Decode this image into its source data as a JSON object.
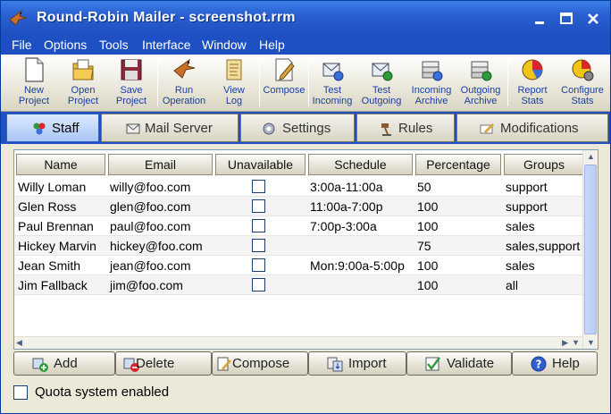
{
  "window": {
    "title": "Round-Robin Mailer - screenshot.rrm"
  },
  "menu": [
    "File",
    "Options",
    "Tools",
    "Interface",
    "Window",
    "Help"
  ],
  "toolbar": [
    {
      "l1": "New",
      "l2": "Project"
    },
    {
      "l1": "Open",
      "l2": "Project"
    },
    {
      "l1": "Save",
      "l2": "Project"
    },
    {
      "l1": "Run",
      "l2": "Operation"
    },
    {
      "l1": "View",
      "l2": "Log"
    },
    {
      "l1": "Compose",
      "l2": ""
    },
    {
      "l1": "Test",
      "l2": "Incoming"
    },
    {
      "l1": "Test",
      "l2": "Outgoing"
    },
    {
      "l1": "Incoming",
      "l2": "Archive"
    },
    {
      "l1": "Outgoing",
      "l2": "Archive"
    },
    {
      "l1": "Report",
      "l2": "Stats"
    },
    {
      "l1": "Configure",
      "l2": "Stats"
    }
  ],
  "tabs": [
    "Staff",
    "Mail Server",
    "Settings",
    "Rules",
    "Modifications"
  ],
  "table": {
    "columns": [
      "Name",
      "Email",
      "Unavailable",
      "Schedule",
      "Percentage",
      "Groups"
    ],
    "rows": [
      {
        "name": "Willy Loman",
        "email": "willy@foo.com",
        "unavailable": false,
        "schedule": "3:00a-11:00a",
        "percentage": "50",
        "groups": "support"
      },
      {
        "name": "Glen Ross",
        "email": "glen@foo.com",
        "unavailable": false,
        "schedule": "11:00a-7:00p",
        "percentage": "100",
        "groups": "support"
      },
      {
        "name": "Paul Brennan",
        "email": "paul@foo.com",
        "unavailable": false,
        "schedule": "7:00p-3:00a",
        "percentage": "100",
        "groups": "sales"
      },
      {
        "name": "Hickey Marvin",
        "email": "hickey@foo.com",
        "unavailable": false,
        "schedule": "",
        "percentage": "75",
        "groups": "sales,support"
      },
      {
        "name": "Jean Smith",
        "email": "jean@foo.com",
        "unavailable": false,
        "schedule": "Mon:9:00a-5:00p",
        "percentage": "100",
        "groups": "sales"
      },
      {
        "name": "Jim Fallback",
        "email": "jim@foo.com",
        "unavailable": false,
        "schedule": "",
        "percentage": "100",
        "groups": "all"
      }
    ]
  },
  "buttons": [
    "Add",
    "Delete",
    "Compose",
    "Import",
    "Validate",
    "Help"
  ],
  "quota": {
    "label": "Quota system enabled",
    "checked": false
  }
}
